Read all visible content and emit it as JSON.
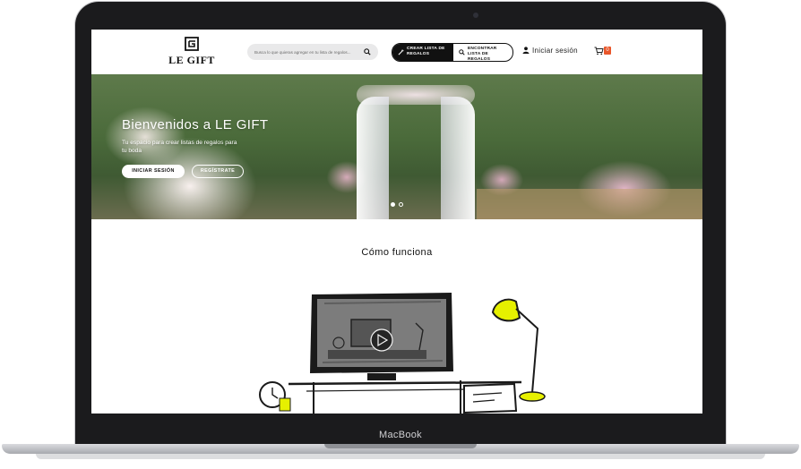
{
  "device": {
    "label": "MacBook"
  },
  "header": {
    "logo_text": "LE GIFT",
    "search_placeholder": "Busca lo que quieras agregar en tu lista de regalos...",
    "cta_create": "CREAR LISTA DE REGALOS",
    "cta_find": "ENCONTRAR LISTA DE REGALOS",
    "login": "Iniciar sesión",
    "cart_count": "0"
  },
  "hero": {
    "title": "Bienvenidos a LE GIFT",
    "subtitle": "Tu espacio para crear listas de regalos para tu boda",
    "login_button": "INICIAR SESIÓN",
    "register_button": "REGÍSTRATE",
    "slides_total": 2,
    "slide_active": 1
  },
  "section": {
    "title": "Cómo funciona"
  },
  "colors": {
    "accent": "#e9562a",
    "highlight": "#e6f000",
    "dark": "#111111"
  },
  "icons": [
    "logo-mark-icon",
    "search-icon",
    "wand-icon",
    "search-icon",
    "user-icon",
    "cart-icon",
    "play-icon"
  ]
}
